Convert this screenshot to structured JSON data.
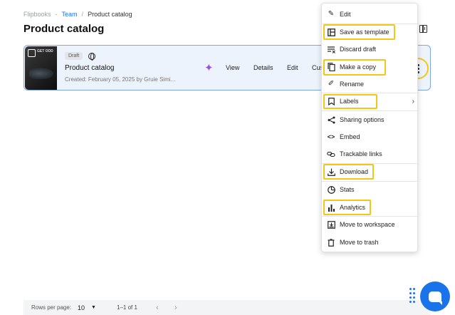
{
  "breadcrumb": {
    "root": "Flipbooks",
    "sep1": "-",
    "team": "Team",
    "sep2": "/",
    "current": "Product catalog"
  },
  "page": {
    "title": "Product catalog"
  },
  "card": {
    "badge": "Draft",
    "title": "Product catalog",
    "meta": "Created: February 05, 2025 by Gruie Simi...",
    "thumb_text": "GET ODD",
    "actions": {
      "view": "View",
      "details": "Details",
      "edit": "Edit",
      "customize": "Customize"
    }
  },
  "menu": {
    "items": [
      {
        "label": "Edit",
        "icon": "pencil-icon"
      },
      {
        "label": "Save as template",
        "icon": "template-icon",
        "highlighted": true
      },
      {
        "label": "Discard draft",
        "icon": "discard-icon"
      },
      {
        "label": "Make a copy",
        "icon": "copy-icon",
        "highlighted": true
      },
      {
        "label": "Rename",
        "icon": "rename-icon"
      },
      {
        "label": "Labels",
        "icon": "label-icon",
        "highlighted": true,
        "submenu": true
      },
      {
        "label": "Sharing options",
        "icon": "share-icon"
      },
      {
        "label": "Embed",
        "icon": "code-icon"
      },
      {
        "label": "Trackable links",
        "icon": "link-icon"
      },
      {
        "label": "Download",
        "icon": "download-icon",
        "highlighted": true
      },
      {
        "label": "Stats",
        "icon": "pie-icon"
      },
      {
        "label": "Analytics",
        "icon": "bar-chart-icon",
        "highlighted": true
      },
      {
        "label": "Move to workspace",
        "icon": "move-icon"
      },
      {
        "label": "Move to trash",
        "icon": "trash-icon"
      }
    ]
  },
  "footer": {
    "rows_label": "Rows per page:",
    "rows_value": "10",
    "range": "1–1 of 1",
    "prev": "‹",
    "next": "›"
  },
  "colors": {
    "accent": "#1a73e8",
    "highlight": "#f5c518",
    "card_bg": "#edf3fc"
  }
}
